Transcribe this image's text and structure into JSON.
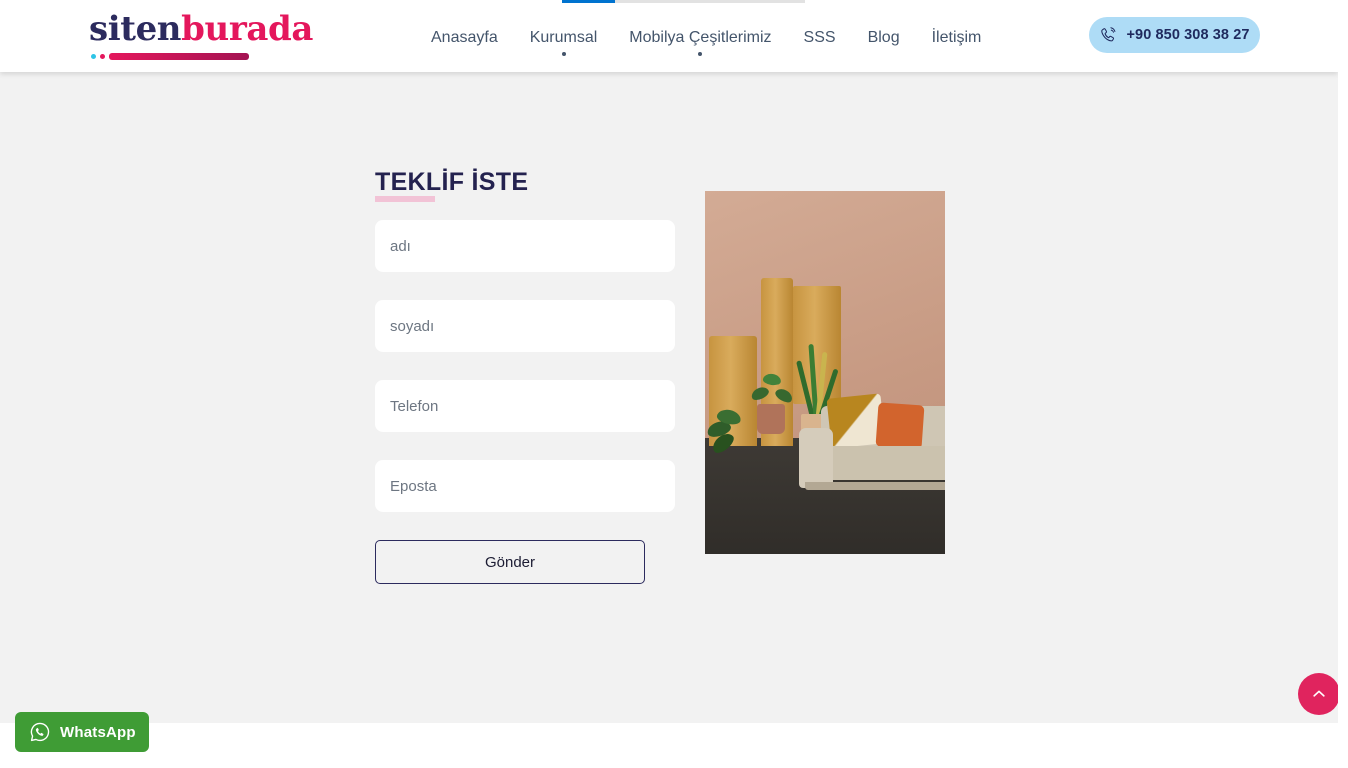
{
  "header": {
    "logo": {
      "name": "sitenburada",
      "part_dark": "siten",
      "part_pink": "burada",
      "color_dark": "#2c2b5e",
      "color_pink": "#e4175c",
      "accent_dot_cyan": "#2ec4e6",
      "accent_dot_pink": "#e4175c"
    },
    "nav": [
      {
        "label": "Anasayfa",
        "has_dropdown_dot": false
      },
      {
        "label": "Kurumsal",
        "has_dropdown_dot": true
      },
      {
        "label": "Mobilya Çeşitlerimiz",
        "has_dropdown_dot": true
      },
      {
        "label": "SSS",
        "has_dropdown_dot": false
      },
      {
        "label": "Blog",
        "has_dropdown_dot": false
      },
      {
        "label": "İletişim",
        "has_dropdown_dot": false
      }
    ],
    "phone": {
      "number": "+90 850 308 38 27",
      "icon": "phone-icon",
      "background": "#aedcf6",
      "text_color": "#1f2a5e"
    },
    "progress_bar": {
      "fill_color": "#0073cf",
      "track_color": "#e2e2e2"
    }
  },
  "main": {
    "heading": "TEKLİF İSTE",
    "heading_color": "#24224f",
    "underline_color": "#f2c3d6",
    "form": {
      "fields": [
        {
          "name": "adi",
          "placeholder": "adı",
          "value": "",
          "type": "text"
        },
        {
          "name": "soyadi",
          "placeholder": "soyadı",
          "value": "",
          "type": "text"
        },
        {
          "name": "telefon",
          "placeholder": "Telefon",
          "value": "",
          "type": "tel"
        },
        {
          "name": "eposta",
          "placeholder": "Eposta",
          "value": "",
          "type": "email"
        }
      ],
      "submit_label": "Gönder",
      "submit_border_color": "#2c2b5e"
    },
    "photo": {
      "alt": "terracotta wall living room with beige sofa, orange and mustard cushions, potted plants on mustard pedestals"
    },
    "background": "#f2f2f2"
  },
  "widgets": {
    "whatsapp": {
      "label": "WhatsApp",
      "icon": "whatsapp-icon",
      "background": "#3f9c35",
      "text_color": "#ffffff"
    },
    "scroll_top": {
      "icon": "chevron-up-icon",
      "background": "#e0245e",
      "icon_color": "#ffffff"
    }
  }
}
